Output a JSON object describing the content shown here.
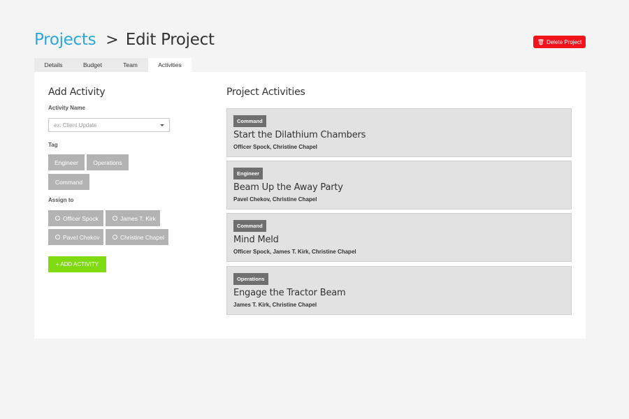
{
  "header": {
    "breadcrumb_root": "Projects",
    "separator": ">",
    "current": "Edit Project"
  },
  "delete_button": {
    "icon": "trash-icon",
    "label": "Delete Project",
    "color": "#f2131d"
  },
  "tabs": [
    {
      "label": "Details",
      "active": false
    },
    {
      "label": "Budget",
      "active": false
    },
    {
      "label": "Team",
      "active": false
    },
    {
      "label": "Activities",
      "active": true
    }
  ],
  "add_activity": {
    "title": "Add Activity",
    "name_label": "Activity Name",
    "name_placeholder": "ex. Client Update",
    "tag_label": "Tag",
    "tags": [
      "Engineer",
      "Operations",
      "Command"
    ],
    "assign_label": "Assign to",
    "assignees": [
      "Officer Spock",
      "James T. Kirk",
      "Pavel Chekov",
      "Christine Chapel"
    ],
    "add_button": "+ ADD ACTIVITY",
    "add_button_color": "#7fdb10"
  },
  "project_activities": {
    "title": "Project Activities",
    "items": [
      {
        "tag": "Command",
        "title": "Start the Dilathium Chambers",
        "people": "Officer Spock, Christine Chapel"
      },
      {
        "tag": "Engineer",
        "title": "Beam Up the Away Party",
        "people": "Pavel Chekov, Christine Chapel"
      },
      {
        "tag": "Command",
        "title": "Mind Meld",
        "people": "Officer Spock, James T. Kirk, Christine Chapel"
      },
      {
        "tag": "Operations",
        "title": "Engage the Tractor Beam",
        "people": "James T. Kirk, Christine Chapel"
      }
    ]
  },
  "colors": {
    "accent": "#2ba6de",
    "tag_bg": "#6f6f6f",
    "chip_bg": "#b3b3b3",
    "card_bg": "#e2e2e2"
  }
}
